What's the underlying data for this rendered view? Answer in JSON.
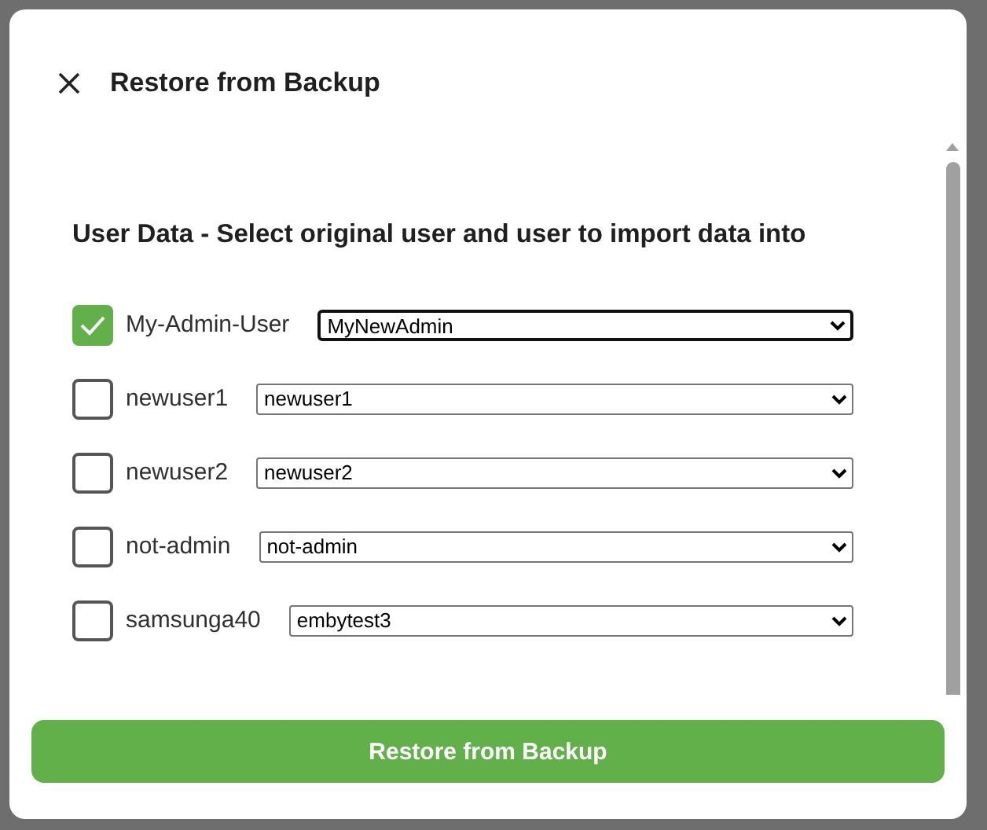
{
  "dialog": {
    "title": "Restore from Backup"
  },
  "section": {
    "heading": "User Data - Select original user and user to import data into"
  },
  "users": [
    {
      "name": "My-Admin-User",
      "checked": true,
      "target": "MyNewAdmin",
      "focused": true
    },
    {
      "name": "newuser1",
      "checked": false,
      "target": "newuser1",
      "focused": false
    },
    {
      "name": "newuser2",
      "checked": false,
      "target": "newuser2",
      "focused": false
    },
    {
      "name": "not-admin",
      "checked": false,
      "target": "not-admin",
      "focused": false
    },
    {
      "name": "samsunga40",
      "checked": false,
      "target": "embytest3",
      "focused": false
    }
  ],
  "button": {
    "label": "Restore from Backup"
  }
}
